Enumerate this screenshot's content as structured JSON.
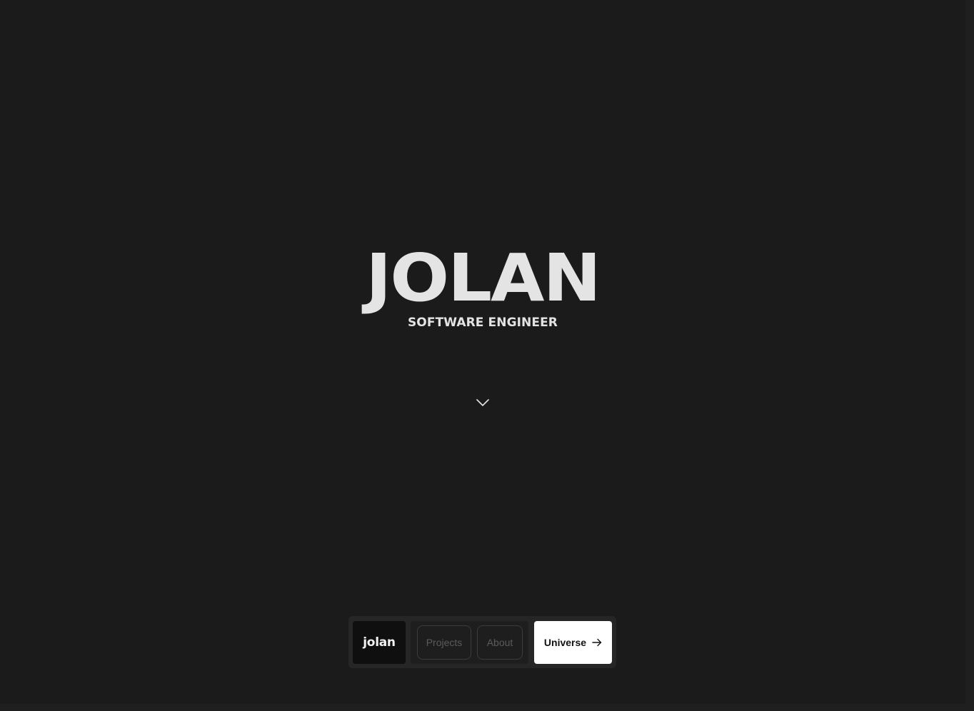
{
  "hero": {
    "title": "JOLAN",
    "subtitle": "SOFTWARE ENGINEER"
  },
  "scroll_indicator": {
    "icon": "chevron-down-icon"
  },
  "nav": {
    "brand": "jolan",
    "links": [
      {
        "label": "Projects"
      },
      {
        "label": "About"
      }
    ],
    "cta": {
      "label": "Universe",
      "icon": "arrow-right-icon"
    }
  },
  "colors": {
    "background": "#1b1b1b",
    "text": "#e4e4e4",
    "nav_bar": "#262626",
    "brand_bg": "#0f0f0f",
    "link_text": "#5b5b5b",
    "cta_bg": "#ffffff",
    "cta_text": "#111111"
  }
}
